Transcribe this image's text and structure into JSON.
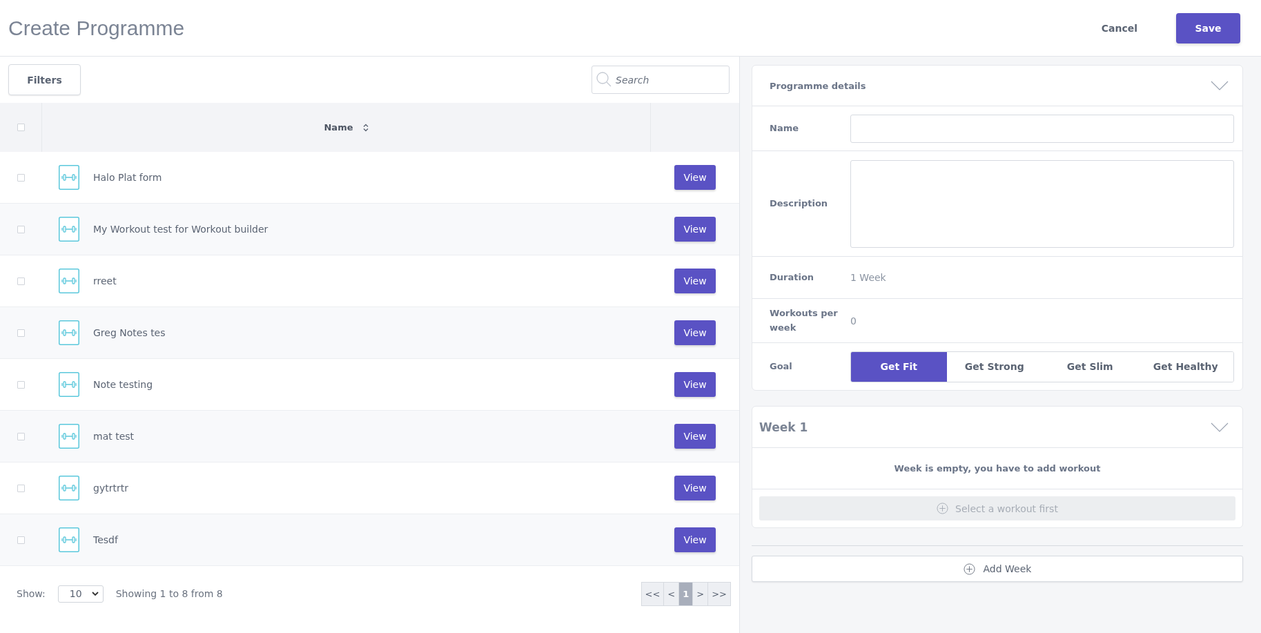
{
  "header": {
    "title": "Create Programme",
    "cancel": "Cancel",
    "save": "Save"
  },
  "toolbar": {
    "filters": "Filters",
    "search": {
      "placeholder": "Search"
    }
  },
  "table": {
    "select_all": {
      "checked": false
    },
    "columns": [
      {
        "label": "Name",
        "sortable": true
      }
    ],
    "rows": [
      {
        "checked": false,
        "name": "Halo Plat form",
        "action": "View"
      },
      {
        "checked": false,
        "name": "My Workout test for Workout builder",
        "action": "View"
      },
      {
        "checked": false,
        "name": "rreet",
        "action": "View"
      },
      {
        "checked": false,
        "name": "Greg Notes tes",
        "action": "View"
      },
      {
        "checked": false,
        "name": "Note testing",
        "action": "View"
      },
      {
        "checked": false,
        "name": "mat test",
        "action": "View"
      },
      {
        "checked": false,
        "name": "gytrtrtr",
        "action": "View"
      },
      {
        "checked": false,
        "name": "Tesdf",
        "action": "View"
      }
    ]
  },
  "footer": {
    "show_label": "Show:",
    "page_size": "10",
    "summary": "Showing 1 to 8 from 8",
    "pages": [
      {
        "label": "<<",
        "selected": false
      },
      {
        "label": "<",
        "selected": false
      },
      {
        "label": "1",
        "selected": true
      },
      {
        "label": ">",
        "selected": false
      },
      {
        "label": ">>",
        "selected": false
      }
    ]
  },
  "details": {
    "title": "Programme details",
    "expanded": true,
    "fields": [
      {
        "kind": "input",
        "label": "Name"
      },
      {
        "kind": "textarea",
        "label": "Description"
      },
      {
        "kind": "text",
        "label": "Duration",
        "value": "1 Week"
      },
      {
        "kind": "text",
        "label": "Workouts per week",
        "value": "0"
      }
    ],
    "goal": {
      "label": "Goal",
      "options": [
        {
          "label": "Get Fit",
          "selected": true
        },
        {
          "label": "Get Strong",
          "selected": false
        },
        {
          "label": "Get Slim",
          "selected": false
        },
        {
          "label": "Get Healthy",
          "selected": false
        }
      ]
    }
  },
  "week": {
    "title": "Week 1",
    "expanded": true,
    "empty_message": "Week is empty, you have to add workout",
    "select_button": {
      "label": "Select a workout first",
      "disabled": true
    }
  },
  "add_week": "Add Week"
}
